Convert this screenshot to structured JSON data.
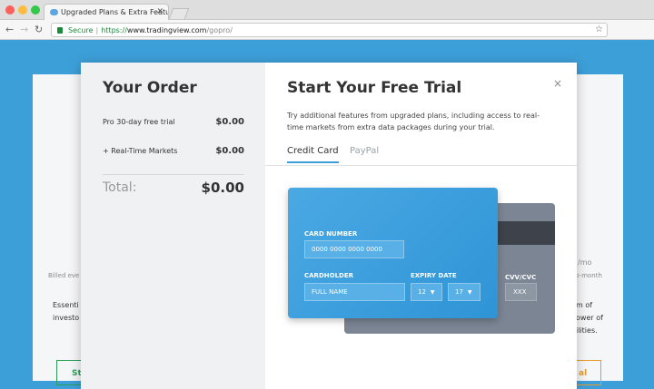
{
  "browser": {
    "tab_title": "Upgraded Plans & Extra Featu",
    "tab_close": "✕",
    "url_secure": "Secure",
    "url_scheme": "https://",
    "url_host": "www.tradingview.com",
    "url_path": "/gopro/"
  },
  "background": {
    "billed_text": "Billed eve",
    "left_desc_line1": "Essenti",
    "left_desc_line2": "investo",
    "right_price": "/mo",
    "right_billing": "-to-month",
    "right_desc_line1": "m of",
    "right_desc_line2": "ower of",
    "right_desc_line3": "ilities.",
    "left_button": "St",
    "right_button": "al"
  },
  "order": {
    "title": "Your Order",
    "items": [
      {
        "label": "Pro 30-day free trial",
        "value": "$0.00"
      },
      {
        "label": "+ Real-Time Markets",
        "value": "$0.00"
      }
    ],
    "total_label": "Total:",
    "total_value": "$0.00"
  },
  "trial": {
    "title": "Start Your Free Trial",
    "close": "×",
    "description": "Try additional features from upgraded plans, including access to real-time markets from extra data packages during your trial.",
    "tabs": [
      {
        "label": "Credit Card",
        "active": true
      },
      {
        "label": "PayPal",
        "active": false
      }
    ]
  },
  "card": {
    "number_label": "CARD NUMBER",
    "number_placeholder": "0000 0000 0000 0000",
    "holder_label": "CARDHOLDER",
    "holder_placeholder": "FULL NAME",
    "expiry_label": "EXPIRY DATE",
    "expiry_month": "12",
    "expiry_year": "17",
    "cvv_label": "CVV/CVC",
    "cvv_placeholder": "XXX"
  },
  "colors": {
    "accent": "#3d9fd8",
    "card_front": "#3b9fdd",
    "card_back": "#7b8594"
  }
}
